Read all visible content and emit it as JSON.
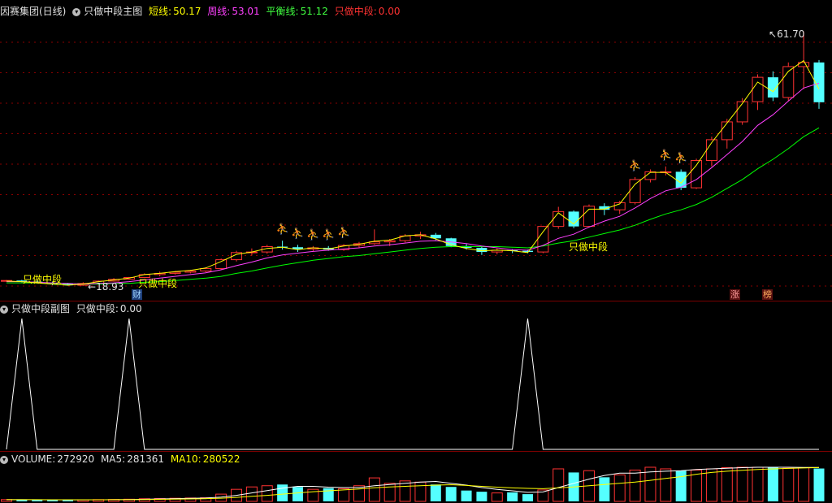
{
  "main_header": {
    "stock_name": "因赛集团(日线)",
    "indicator_name": "只做中段主图",
    "short_label": "短线:",
    "short_value": "50.17",
    "week_label": "周线:",
    "week_value": "53.01",
    "balance_label": "平衡线:",
    "balance_value": "51.12",
    "mid_label": "只做中段:",
    "mid_value": "0.00"
  },
  "main_annotations": {
    "high_price": "61.70",
    "low_price": "18.93",
    "signal_text": "只做中段",
    "badge_cai": "财",
    "badge_zhang": "涨",
    "badge_bang": "榜"
  },
  "sub_header": {
    "indicator_name": "只做中段副图",
    "mid_label": "只做中段:",
    "mid_value": "0.00"
  },
  "volume_header": {
    "vol_label": "VOLUME:",
    "vol_value": "272920",
    "ma5_label": "MA5:",
    "ma5_value": "281361",
    "ma10_label": "MA10:",
    "ma10_value": "280522"
  },
  "colors": {
    "short": "#ffff00",
    "week": "#ff40ff",
    "balance": "#00ff00",
    "up": "#ff3232",
    "down": "#54ffff",
    "signal": "#ffcc00"
  },
  "chart_data": [
    {
      "type": "candlestick",
      "title": "因赛集团(日线)",
      "candles": [
        [
          19.7,
          19.9,
          19.6,
          19.8
        ],
        [
          19.8,
          19.9,
          19.5,
          19.6
        ],
        [
          19.6,
          19.8,
          19.3,
          19.4
        ],
        [
          19.4,
          19.6,
          19.0,
          19.2
        ],
        [
          19.2,
          19.4,
          18.93,
          19.0
        ],
        [
          19.0,
          19.5,
          18.9,
          19.3
        ],
        [
          19.3,
          19.8,
          19.2,
          19.7
        ],
        [
          19.7,
          20.2,
          19.6,
          20.0
        ],
        [
          20.0,
          20.4,
          19.9,
          20.3
        ],
        [
          20.3,
          21.0,
          20.2,
          20.8
        ],
        [
          20.8,
          21.3,
          20.5,
          21.0
        ],
        [
          21.0,
          21.4,
          20.8,
          21.2
        ],
        [
          21.2,
          21.6,
          21.0,
          21.4
        ],
        [
          21.4,
          22.0,
          21.2,
          21.8
        ],
        [
          21.8,
          23.5,
          21.6,
          23.3
        ],
        [
          23.3,
          24.8,
          23.0,
          24.5
        ],
        [
          24.5,
          25.2,
          24.0,
          24.6
        ],
        [
          24.6,
          25.8,
          24.3,
          25.5
        ],
        [
          25.5,
          26.5,
          25.0,
          25.4
        ],
        [
          25.4,
          25.8,
          24.6,
          25.1
        ],
        [
          25.1,
          25.6,
          24.7,
          25.3
        ],
        [
          25.3,
          25.6,
          24.8,
          25.0
        ],
        [
          25.0,
          25.9,
          24.8,
          25.7
        ],
        [
          25.7,
          26.3,
          25.3,
          26.0
        ],
        [
          26.0,
          28.4,
          25.8,
          26.3
        ],
        [
          26.3,
          26.8,
          25.6,
          26.5
        ],
        [
          26.5,
          27.6,
          26.2,
          27.3
        ],
        [
          27.3,
          28.0,
          26.8,
          27.5
        ],
        [
          27.5,
          27.8,
          26.6,
          26.9
        ],
        [
          26.9,
          27.0,
          25.4,
          25.6
        ],
        [
          25.6,
          26.0,
          25.0,
          25.3
        ],
        [
          25.3,
          25.5,
          24.1,
          24.6
        ],
        [
          24.6,
          25.2,
          24.2,
          24.9
        ],
        [
          24.9,
          25.1,
          24.4,
          24.8
        ],
        [
          24.8,
          25.0,
          24.4,
          24.6
        ],
        [
          24.6,
          29.0,
          24.4,
          28.9
        ],
        [
          28.9,
          32.2,
          28.5,
          31.4
        ],
        [
          31.4,
          31.6,
          28.6,
          28.9
        ],
        [
          28.9,
          32.6,
          28.7,
          32.3
        ],
        [
          32.3,
          32.8,
          30.8,
          31.7
        ],
        [
          31.7,
          33.2,
          31.0,
          32.9
        ],
        [
          32.9,
          37.2,
          32.6,
          36.8
        ],
        [
          36.8,
          38.5,
          36.3,
          38.1
        ],
        [
          38.1,
          39.0,
          37.5,
          38.1
        ],
        [
          38.1,
          38.5,
          35.0,
          35.4
        ],
        [
          35.4,
          40.3,
          35.2,
          40.0
        ],
        [
          40.0,
          44.0,
          39.0,
          43.5
        ],
        [
          43.5,
          47.0,
          42.0,
          46.5
        ],
        [
          46.5,
          50.5,
          46.0,
          49.9
        ],
        [
          49.9,
          54.5,
          48.5,
          54.0
        ],
        [
          54.0,
          55.0,
          50.0,
          50.6
        ],
        [
          50.6,
          56.5,
          50.0,
          55.8
        ],
        [
          55.8,
          61.7,
          52.0,
          56.5
        ],
        [
          56.5,
          56.9,
          48.7,
          49.8
        ]
      ],
      "candle_encoding": "[open, high, low, close]",
      "short_line": [
        19.7,
        19.6,
        19.4,
        19.2,
        19.0,
        19.2,
        19.6,
        19.9,
        20.2,
        20.8,
        21.0,
        21.3,
        21.5,
        21.9,
        23.0,
        24.2,
        24.6,
        25.2,
        25.4,
        25.0,
        25.3,
        25.1,
        25.6,
        25.9,
        26.4,
        26.6,
        27.3,
        27.5,
        26.8,
        25.8,
        25.2,
        24.8,
        24.9,
        24.8,
        24.5,
        28.0,
        31.2,
        29.3,
        31.8,
        31.8,
        32.7,
        36.0,
        38.0,
        38.0,
        36.2,
        39.2,
        43.0,
        46.3,
        49.6,
        53.2,
        51.6,
        55.0,
        56.8,
        52.0
      ],
      "week_line": [
        19.6,
        19.6,
        19.5,
        19.4,
        19.3,
        19.2,
        19.3,
        19.4,
        19.6,
        19.9,
        20.2,
        20.5,
        20.8,
        21.1,
        21.6,
        22.3,
        22.9,
        23.6,
        24.1,
        24.4,
        24.7,
        24.9,
        25.1,
        25.3,
        25.6,
        25.8,
        26.1,
        26.4,
        26.5,
        26.3,
        26.0,
        25.6,
        25.3,
        25.0,
        24.9,
        25.7,
        26.9,
        27.6,
        28.8,
        29.8,
        30.6,
        32.0,
        33.6,
        34.9,
        35.5,
        36.8,
        38.8,
        41.0,
        43.2,
        45.9,
        47.7,
        50.0,
        52.2,
        53.0
      ],
      "balance_line": [
        19.4,
        19.4,
        19.4,
        19.3,
        19.3,
        19.2,
        19.2,
        19.3,
        19.3,
        19.5,
        19.6,
        19.8,
        20.0,
        20.2,
        20.5,
        21.0,
        21.4,
        21.9,
        22.4,
        22.8,
        23.2,
        23.5,
        23.8,
        24.0,
        24.3,
        24.6,
        24.9,
        25.2,
        25.4,
        25.5,
        25.5,
        25.5,
        25.5,
        25.4,
        25.3,
        25.6,
        26.1,
        26.5,
        27.1,
        27.7,
        28.3,
        29.1,
        30.1,
        31.0,
        31.7,
        32.6,
        33.8,
        35.3,
        36.8,
        38.6,
        40.2,
        42.0,
        44.0,
        45.5
      ],
      "ylim": [
        17.5,
        64.0
      ]
    },
    {
      "type": "line",
      "title": "只做中段副图",
      "values": [
        0,
        1,
        0,
        0,
        0,
        0,
        0,
        0,
        1,
        0,
        0,
        0,
        0,
        0,
        0,
        0,
        0,
        0,
        0,
        0,
        0,
        0,
        0,
        0,
        0,
        0,
        0,
        0,
        0,
        0,
        0,
        0,
        0,
        0,
        1,
        0,
        0,
        0,
        0,
        0,
        0,
        0,
        0,
        0,
        0,
        0,
        0,
        0,
        0,
        0,
        0,
        0,
        0,
        0
      ],
      "ylim": [
        0,
        1
      ]
    },
    {
      "type": "bar",
      "title": "VOLUME",
      "values": [
        15000,
        14000,
        13000,
        12000,
        11000,
        13000,
        15000,
        16000,
        18000,
        22000,
        24000,
        26000,
        28000,
        30000,
        60000,
        100000,
        120000,
        130000,
        140000,
        120000,
        100000,
        110000,
        105000,
        130000,
        195000,
        150000,
        170000,
        160000,
        140000,
        120000,
        90000,
        80000,
        70000,
        75000,
        60000,
        95000,
        270000,
        240000,
        255000,
        200000,
        220000,
        260000,
        290000,
        270000,
        255000,
        260000,
        270000,
        280000,
        295000,
        310000,
        285000,
        275000,
        280000,
        272920
      ],
      "ma5": [
        14000,
        14000,
        13500,
        13000,
        13000,
        13000,
        13500,
        14500,
        15500,
        17500,
        20000,
        23000,
        25000,
        27500,
        35000,
        50000,
        70000,
        90000,
        110000,
        125000,
        125000,
        118000,
        115000,
        115000,
        130000,
        140000,
        150000,
        160000,
        165000,
        150000,
        135000,
        115000,
        100000,
        88000,
        75000,
        78000,
        115000,
        150000,
        185000,
        215000,
        235000,
        235000,
        245000,
        250000,
        255000,
        265000,
        270000,
        275000,
        280000,
        283000,
        285000,
        283000,
        282000,
        281361
      ],
      "ma10": [
        14000,
        14000,
        14000,
        13800,
        13500,
        13500,
        13500,
        14000,
        14500,
        15500,
        17000,
        18500,
        20000,
        22000,
        26000,
        33000,
        42000,
        50000,
        60000,
        70000,
        80000,
        88000,
        95000,
        103000,
        113000,
        120000,
        125000,
        130000,
        135000,
        138000,
        132000,
        125000,
        118000,
        112000,
        108000,
        105000,
        112000,
        120000,
        130000,
        140000,
        150000,
        160000,
        175000,
        190000,
        205000,
        225000,
        240000,
        250000,
        258000,
        265000,
        270000,
        274000,
        277000,
        280522
      ],
      "ylim": [
        0,
        340000
      ]
    }
  ]
}
